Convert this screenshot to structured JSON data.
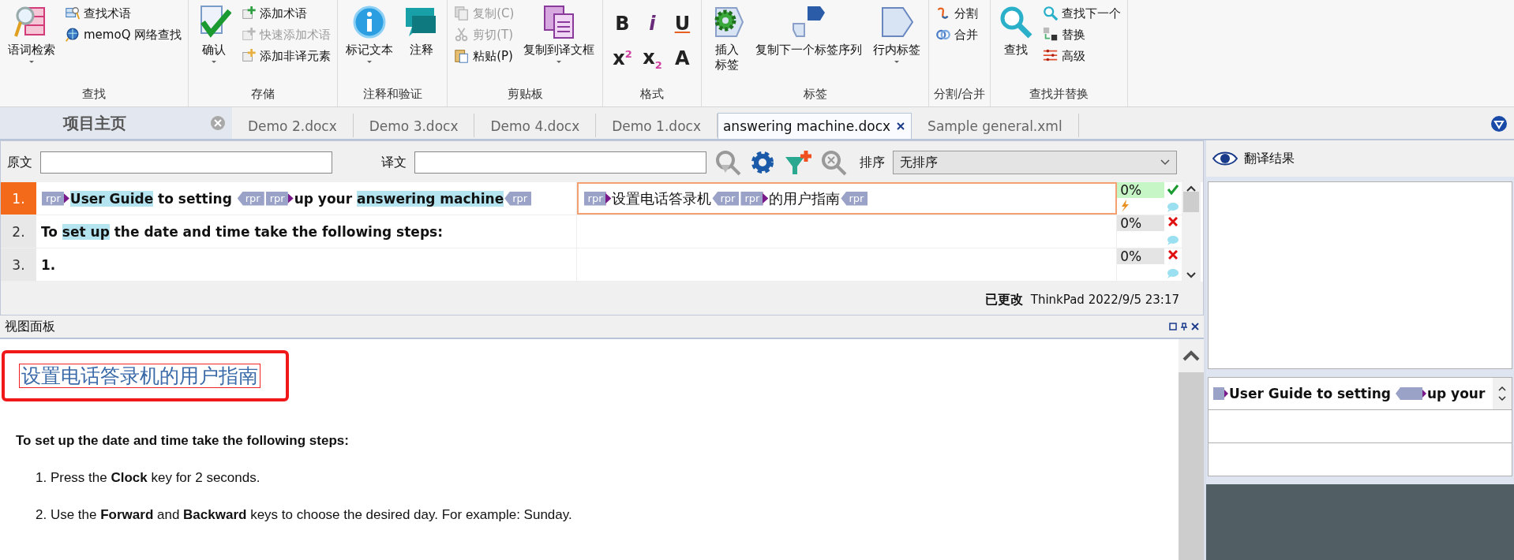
{
  "ribbon": {
    "groups": [
      {
        "label": "查找",
        "items": [
          {
            "kind": "large",
            "label": "语词检索",
            "dropdown": true,
            "disabled": false
          },
          {
            "kind": "small",
            "label": "查找术语",
            "dropdown": false,
            "disabled": false
          },
          {
            "kind": "small",
            "label": "memoQ 网络查找",
            "dropdown": false,
            "disabled": false
          }
        ]
      },
      {
        "label": "存储",
        "items": [
          {
            "kind": "large",
            "label": "确认",
            "dropdown": true,
            "disabled": false
          },
          {
            "kind": "small",
            "label": "添加术语",
            "dropdown": false,
            "disabled": false
          },
          {
            "kind": "small",
            "label": "快速添加术语",
            "dropdown": false,
            "disabled": true
          },
          {
            "kind": "small",
            "label": "添加非译元素",
            "dropdown": false,
            "disabled": false
          }
        ]
      },
      {
        "label": "注释和验证",
        "items": [
          {
            "kind": "large",
            "label": "标记文本",
            "dropdown": true,
            "disabled": false
          },
          {
            "kind": "large",
            "label": "注释",
            "dropdown": false,
            "disabled": false
          }
        ]
      },
      {
        "label": "剪贴板",
        "items": [
          {
            "kind": "small",
            "label": "复制(C)",
            "dropdown": false,
            "disabled": true
          },
          {
            "kind": "small",
            "label": "剪切(T)",
            "dropdown": false,
            "disabled": true
          },
          {
            "kind": "small",
            "label": "粘贴(P)",
            "dropdown": false,
            "disabled": false
          },
          {
            "kind": "large",
            "label": "复制到译文框",
            "dropdown": true,
            "disabled": false
          }
        ]
      },
      {
        "label": "格式",
        "items": [
          {
            "kind": "format",
            "label": "B"
          },
          {
            "kind": "format",
            "label": "i"
          },
          {
            "kind": "format",
            "label": "U"
          },
          {
            "kind": "format",
            "label": "x$^{2}$"
          },
          {
            "kind": "format",
            "label": "x$_{2}$"
          },
          {
            "kind": "format",
            "label": "A"
          }
        ]
      },
      {
        "label": "标签",
        "items": [
          {
            "kind": "large",
            "label": "插入标签",
            "dropdown": false,
            "disabled": false
          },
          {
            "kind": "large",
            "label": "复制下一个标签序列",
            "dropdown": false,
            "disabled": false
          },
          {
            "kind": "large",
            "label": "行内标签",
            "dropdown": true,
            "disabled": false
          }
        ]
      },
      {
        "label": "分割/合并",
        "items": [
          {
            "kind": "small",
            "label": "分割",
            "dropdown": false,
            "disabled": false
          },
          {
            "kind": "small",
            "label": "合并",
            "dropdown": false,
            "disabled": false
          }
        ]
      },
      {
        "label": "查找并替换",
        "items": [
          {
            "kind": "large",
            "label": "查找",
            "dropdown": false,
            "disabled": false
          },
          {
            "kind": "small",
            "label": "查找下一个",
            "dropdown": false,
            "disabled": false
          },
          {
            "kind": "small",
            "label": "替换",
            "dropdown": false,
            "disabled": false
          },
          {
            "kind": "small",
            "label": "高级",
            "dropdown": false,
            "disabled": false
          }
        ]
      }
    ]
  },
  "home_tab": {
    "label": "项目主页"
  },
  "tabs": [
    {
      "label": "Demo 2.docx",
      "selected": false
    },
    {
      "label": "Demo 3.docx",
      "selected": false
    },
    {
      "label": "Demo 4.docx",
      "selected": false
    },
    {
      "label": "Demo 1.docx",
      "selected": false
    },
    {
      "label": "answering machine.docx",
      "selected": true
    },
    {
      "label": "Sample general.xml",
      "selected": false
    }
  ],
  "filter": {
    "source_label": "原文",
    "target_label": "译文",
    "sort_label": "排序",
    "sort_value": "无排序"
  },
  "rows": [
    {
      "number": "1.",
      "selected": true,
      "confirmed": true,
      "modified": true,
      "match": "0%",
      "source": [
        {
          "kind": "tag_open",
          "label": "rpr"
        },
        {
          "kind": "text",
          "text": "User Guide",
          "highlight": true
        },
        {
          "kind": "text",
          "text": " to setting ",
          "highlight": false
        },
        {
          "kind": "tag_close",
          "label": "rpr"
        },
        {
          "kind": "tag_open",
          "label": "rpr"
        },
        {
          "kind": "text",
          "text": "up your ",
          "highlight": false
        },
        {
          "kind": "text",
          "text": "answering machine",
          "highlight": true
        },
        {
          "kind": "tag_close",
          "label": "rpr"
        }
      ],
      "target": [
        {
          "kind": "tag_open",
          "label": "rpr"
        },
        {
          "kind": "text",
          "text": "设置电话答录机",
          "highlight": false
        },
        {
          "kind": "tag_close",
          "label": "rpr"
        },
        {
          "kind": "tag_open",
          "label": "rpr"
        },
        {
          "kind": "text",
          "text": "的用户指南",
          "highlight": false
        },
        {
          "kind": "tag_close",
          "label": "rpr"
        }
      ]
    },
    {
      "number": "2.",
      "selected": false,
      "confirmed": false,
      "modified": false,
      "match": "0%",
      "source": [
        {
          "kind": "text",
          "text": "To ",
          "highlight": false
        },
        {
          "kind": "text",
          "text": "set up",
          "highlight": true
        },
        {
          "kind": "text",
          "text": " the date and time take the following steps:",
          "highlight": false
        }
      ],
      "target": []
    },
    {
      "number": "3.",
      "selected": false,
      "confirmed": false,
      "modified": false,
      "match": "0%",
      "source": [
        {
          "kind": "text",
          "text": "1.",
          "highlight": false
        }
      ],
      "target": []
    }
  ],
  "status_line": {
    "state": "已更改",
    "info": "ThinkPad 2022/9/5 23:17"
  },
  "view_panel": {
    "title": "视图面板",
    "heading": {
      "text": "设置电话答录机的用户指南",
      "selected": true,
      "highlighted": true
    },
    "paragraph": "To set up the date and time take the following steps:",
    "list": [
      "1. Press the **Clock** key for 2 seconds.",
      "2. Use the **Forward** and **Backward** keys to choose the desired day. For example: Sunday."
    ]
  },
  "results_panel": {
    "title": "翻译结果",
    "preview": [
      {
        "kind": "tag_open"
      },
      {
        "kind": "text",
        "text": "User Guide to setting "
      },
      {
        "kind": "tag_close"
      },
      {
        "kind": "tag_open"
      },
      {
        "kind": "text",
        "text": "up your"
      }
    ]
  }
}
